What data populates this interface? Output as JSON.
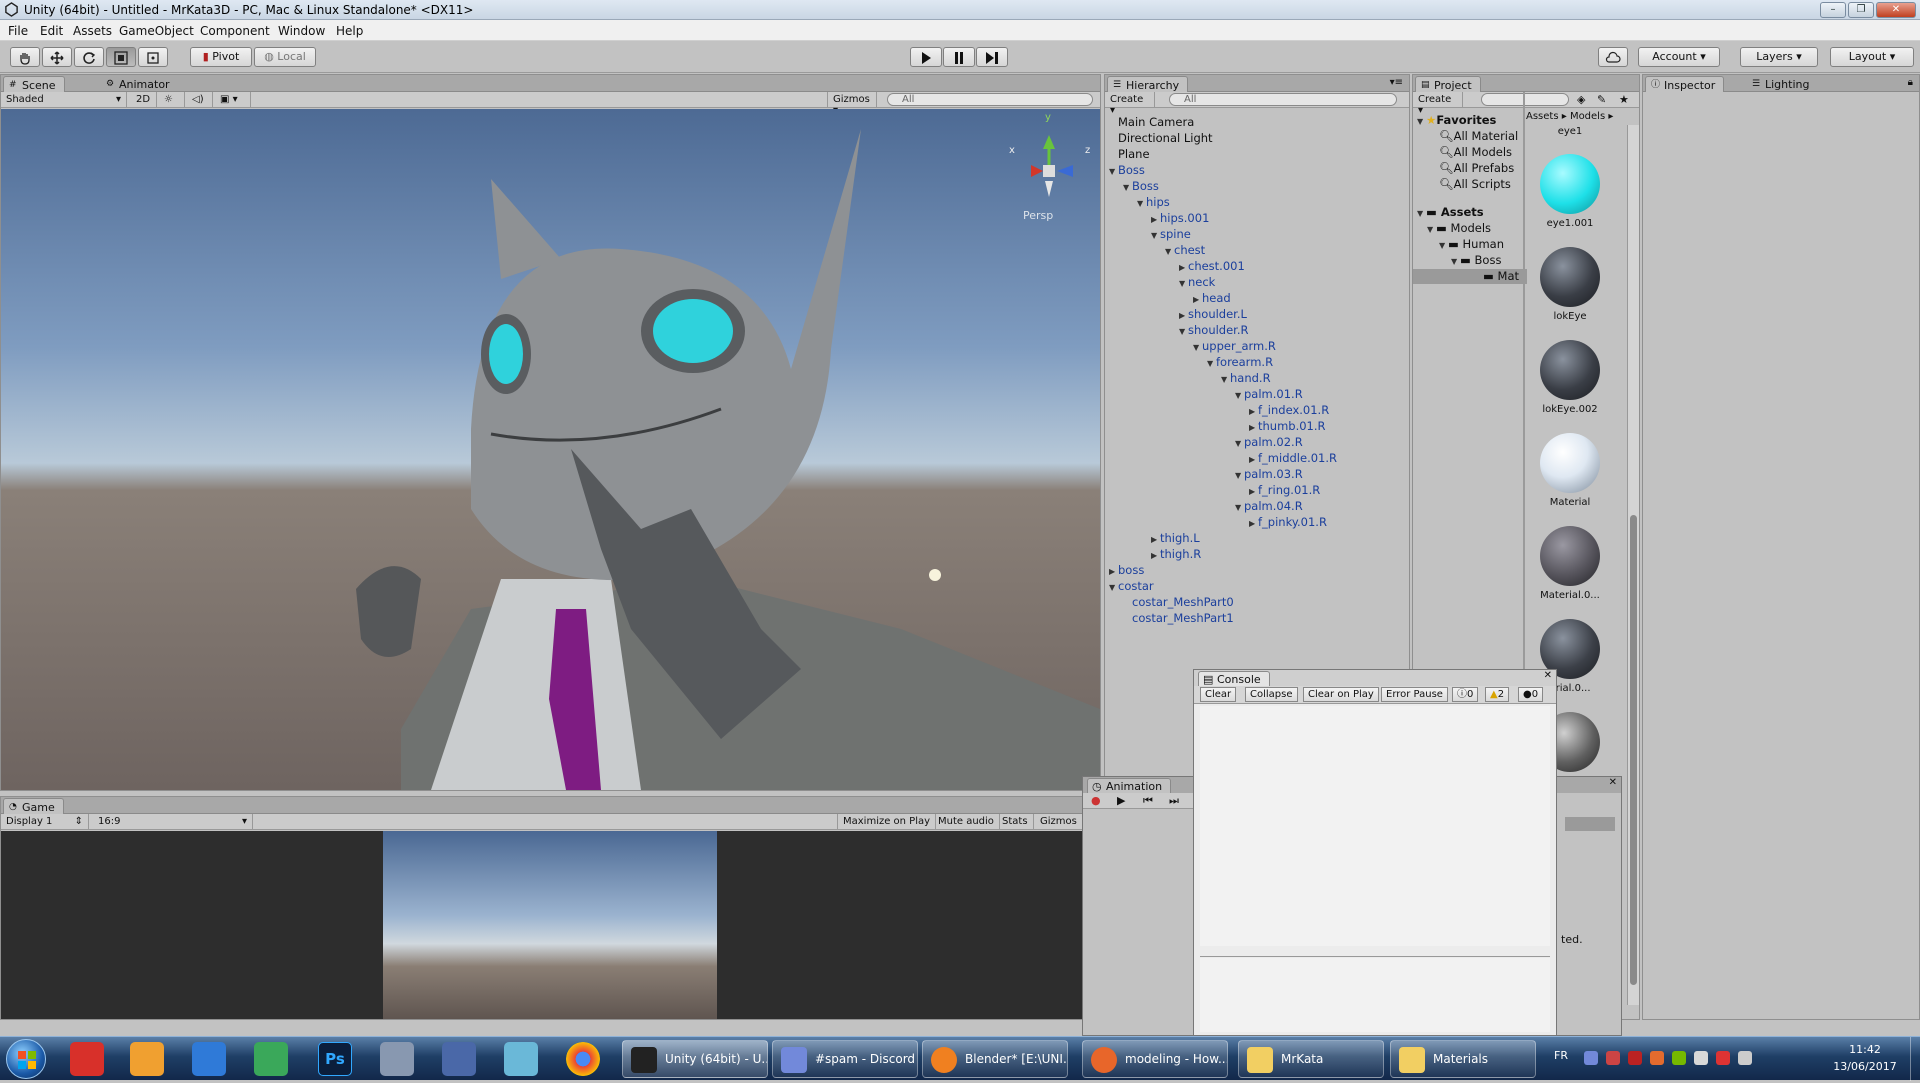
{
  "window": {
    "title": "Unity (64bit) - Untitled - MrKata3D - PC, Mac & Linux Standalone* <DX11>"
  },
  "menu": [
    "File",
    "Edit",
    "Assets",
    "GameObject",
    "Component",
    "Window",
    "Help"
  ],
  "toolbar": {
    "pivot": "Pivot",
    "local": "Local",
    "account": "Account",
    "layers": "Layers",
    "layout": "Layout"
  },
  "scene": {
    "tab_scene": "Scene",
    "tab_animator": "Animator",
    "shading": "Shaded",
    "mode2d": "2D",
    "gizmos": "Gizmos",
    "search_placeholder": "All",
    "persp": "Persp",
    "axis_y": "y",
    "axis_x": "x",
    "axis_z": "z"
  },
  "game": {
    "tab": "Game",
    "display": "Display 1",
    "aspect": "16:9",
    "maximize": "Maximize on Play",
    "mute": "Mute audio",
    "stats": "Stats",
    "gizmos": "Gizmos"
  },
  "hierarchy": {
    "tab": "Hierarchy",
    "create": "Create",
    "search_placeholder": "All",
    "items": [
      {
        "label": "Main Camera",
        "depth": 0,
        "arrow": "",
        "blue": false
      },
      {
        "label": "Directional Light",
        "depth": 0,
        "arrow": "",
        "blue": false
      },
      {
        "label": "Plane",
        "depth": 0,
        "arrow": "",
        "blue": false
      },
      {
        "label": "Boss",
        "depth": 0,
        "arrow": "down",
        "blue": true
      },
      {
        "label": "Boss",
        "depth": 1,
        "arrow": "down",
        "blue": true
      },
      {
        "label": "hips",
        "depth": 2,
        "arrow": "down",
        "blue": true
      },
      {
        "label": "hips.001",
        "depth": 3,
        "arrow": "right",
        "blue": true
      },
      {
        "label": "spine",
        "depth": 3,
        "arrow": "down",
        "blue": true
      },
      {
        "label": "chest",
        "depth": 4,
        "arrow": "down",
        "blue": true
      },
      {
        "label": "chest.001",
        "depth": 5,
        "arrow": "right",
        "blue": true
      },
      {
        "label": "neck",
        "depth": 5,
        "arrow": "down",
        "blue": true
      },
      {
        "label": "head",
        "depth": 6,
        "arrow": "right",
        "blue": true
      },
      {
        "label": "shoulder.L",
        "depth": 5,
        "arrow": "right",
        "blue": true
      },
      {
        "label": "shoulder.R",
        "depth": 5,
        "arrow": "down",
        "blue": true
      },
      {
        "label": "upper_arm.R",
        "depth": 6,
        "arrow": "down",
        "blue": true
      },
      {
        "label": "forearm.R",
        "depth": 7,
        "arrow": "down",
        "blue": true
      },
      {
        "label": "hand.R",
        "depth": 8,
        "arrow": "down",
        "blue": true
      },
      {
        "label": "palm.01.R",
        "depth": 9,
        "arrow": "down",
        "blue": true
      },
      {
        "label": "f_index.01.R",
        "depth": 10,
        "arrow": "right",
        "blue": true
      },
      {
        "label": "thumb.01.R",
        "depth": 10,
        "arrow": "right",
        "blue": true
      },
      {
        "label": "palm.02.R",
        "depth": 9,
        "arrow": "down",
        "blue": true
      },
      {
        "label": "f_middle.01.R",
        "depth": 10,
        "arrow": "right",
        "blue": true
      },
      {
        "label": "palm.03.R",
        "depth": 9,
        "arrow": "down",
        "blue": true
      },
      {
        "label": "f_ring.01.R",
        "depth": 10,
        "arrow": "right",
        "blue": true
      },
      {
        "label": "palm.04.R",
        "depth": 9,
        "arrow": "down",
        "blue": true
      },
      {
        "label": "f_pinky.01.R",
        "depth": 10,
        "arrow": "right",
        "blue": true
      },
      {
        "label": "thigh.L",
        "depth": 3,
        "arrow": "right",
        "blue": true
      },
      {
        "label": "thigh.R",
        "depth": 3,
        "arrow": "right",
        "blue": true
      },
      {
        "label": "boss",
        "depth": 0,
        "arrow": "right",
        "blue": true
      },
      {
        "label": "costar",
        "depth": 0,
        "arrow": "down",
        "blue": true
      },
      {
        "label": "costar_MeshPart0",
        "depth": 1,
        "arrow": "",
        "blue": true
      },
      {
        "label": "costar_MeshPart1",
        "depth": 1,
        "arrow": "",
        "blue": true
      }
    ]
  },
  "project": {
    "tab": "Project",
    "create": "Create",
    "breadcrumb": [
      "Assets",
      "Models"
    ],
    "favorites_header": "Favorites",
    "favorites": [
      "All Material",
      "All Models",
      "All Prefabs",
      "All Scripts"
    ],
    "assets_header": "Assets",
    "tree": [
      "Models",
      "Human",
      "Boss",
      "Mat"
    ],
    "materials": [
      {
        "name": "eye1",
        "color": "#cfcfcf"
      },
      {
        "name": "eye1.001",
        "color": "#1ee0e8"
      },
      {
        "name": "lokEye",
        "color": "#3a3e46"
      },
      {
        "name": "lokEye.002",
        "color": "#3a3e46"
      },
      {
        "name": "Material",
        "color": "#e6eef6"
      },
      {
        "name": "Material.0...",
        "color": "#56545c"
      },
      {
        "name": "erial.0...",
        "color": "#3c4048"
      }
    ]
  },
  "inspector": {
    "tab": "Inspector",
    "lighting": "Lighting"
  },
  "console": {
    "title": "Console",
    "clear": "Clear",
    "collapse": "Collapse",
    "clear_on_play": "Clear on Play",
    "error_pause": "Error Pause",
    "info_count": "0",
    "warn_count": "2",
    "error_count": "0"
  },
  "animation": {
    "title": "Animation",
    "partial_text": "ted."
  },
  "taskbar": {
    "items": [
      "Unity (64bit) - U...",
      "#spam - Discord",
      "Blender* [E:\\UNI...",
      "modeling - How...",
      "MrKata",
      "Materials"
    ],
    "lang": "FR",
    "time": "11:42",
    "date": "13/06/2017"
  }
}
